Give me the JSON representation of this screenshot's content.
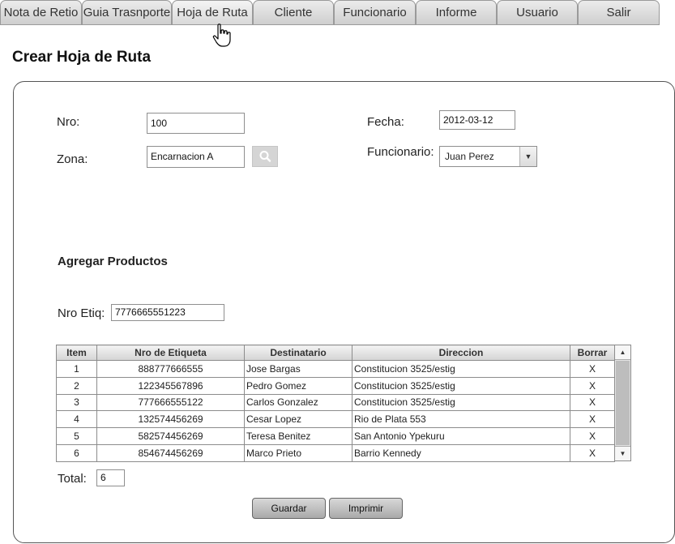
{
  "tabs": [
    {
      "label": "Nota de Retio"
    },
    {
      "label": "Guia Trasnporte"
    },
    {
      "label": "Hoja de Ruta"
    },
    {
      "label": "Cliente"
    },
    {
      "label": "Funcionario"
    },
    {
      "label": "Informe"
    },
    {
      "label": "Usuario"
    },
    {
      "label": "Salir"
    }
  ],
  "page_title": "Crear Hoja de Ruta",
  "form": {
    "nro_label": "Nro:",
    "nro_value": "100",
    "fecha_label": "Fecha:",
    "fecha_value": "2012-03-12",
    "zona_label": "Zona:",
    "zona_value": "Encarnacion A",
    "funcionario_label": "Funcionario:",
    "funcionario_value": "Juan Perez"
  },
  "products": {
    "section_title": "Agregar Productos",
    "etiq_label": "Nro Etiq:",
    "etiq_value": "7776665551223",
    "columns": [
      "Item",
      "Nro de Etiqueta",
      "Destinatario",
      "Direccion",
      "Borrar"
    ],
    "rows": [
      {
        "item": "1",
        "etiqueta": "888777666555",
        "destinatario": "Jose Bargas",
        "direccion": "Constitucion 3525/estig",
        "borrar": "X"
      },
      {
        "item": "2",
        "etiqueta": "122345567896",
        "destinatario": "Pedro Gomez",
        "direccion": "Constitucion 3525/estig",
        "borrar": "X"
      },
      {
        "item": "3",
        "etiqueta": "777666555122",
        "destinatario": "Carlos Gonzalez",
        "direccion": "Constitucion 3525/estig",
        "borrar": "X"
      },
      {
        "item": "4",
        "etiqueta": "132574456269",
        "destinatario": "Cesar Lopez",
        "direccion": "Rio de Plata 553",
        "borrar": "X"
      },
      {
        "item": "5",
        "etiqueta": "582574456269",
        "destinatario": "Teresa Benitez",
        "direccion": "San Antonio Ypekuru",
        "borrar": "X"
      },
      {
        "item": "6",
        "etiqueta": "854674456269",
        "destinatario": "Marco Prieto",
        "direccion": "Barrio Kennedy",
        "borrar": "X"
      }
    ],
    "total_label": "Total:",
    "total_value": "6"
  },
  "buttons": {
    "save": "Guardar",
    "print": "Imprimir"
  },
  "icons": {
    "search": "search-icon",
    "dropdown": "chevron-down-icon",
    "cursor": "hand-pointer-icon"
  }
}
